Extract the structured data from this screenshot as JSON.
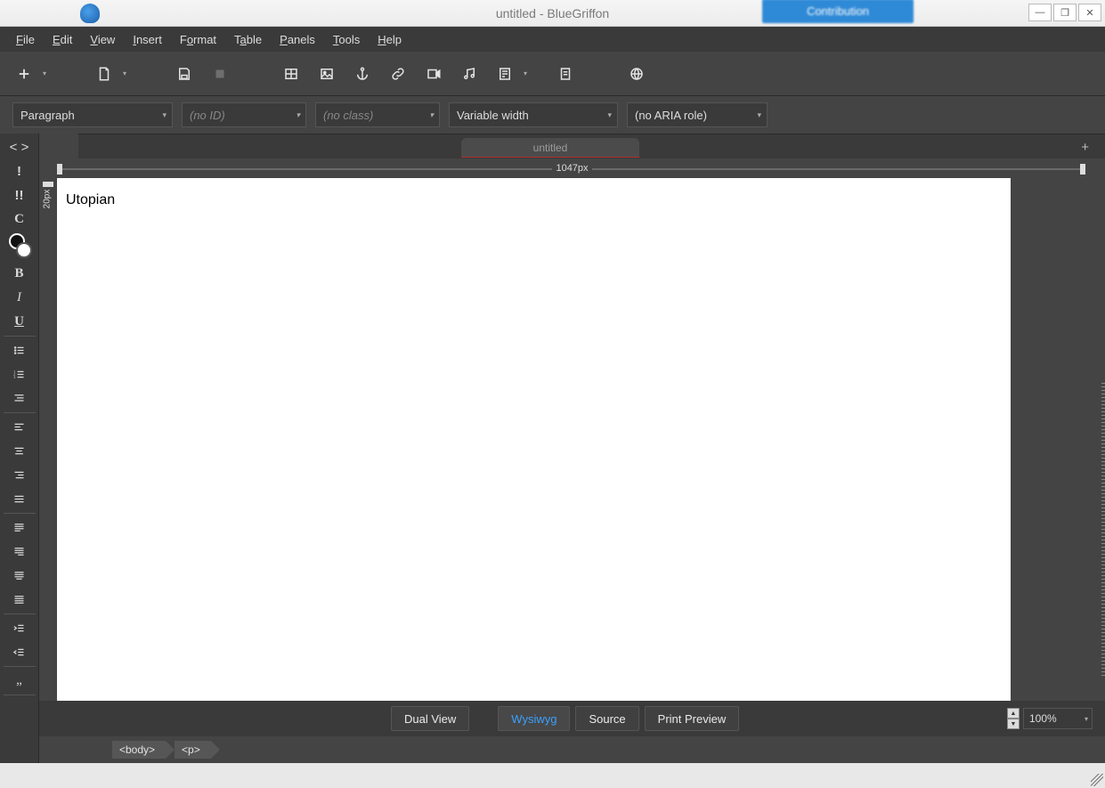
{
  "window": {
    "title": "untitled - BlueGriffon",
    "controls": {
      "min": "—",
      "max": "❐",
      "close": "✕"
    },
    "contribution_label": "Contribution"
  },
  "menu": {
    "items": [
      "File",
      "Edit",
      "View",
      "Insert",
      "Format",
      "Table",
      "Panels",
      "Tools",
      "Help"
    ]
  },
  "format_selects": {
    "paragraph": "Paragraph",
    "id_placeholder": "(no ID)",
    "class_placeholder": "(no class)",
    "font": "Variable width",
    "aria": "(no ARIA role)"
  },
  "tabs": {
    "active": "untitled",
    "new_tab": "+"
  },
  "ruler": {
    "width_label": "1047px",
    "v_label": "20px"
  },
  "document": {
    "content": "Utopian"
  },
  "view_buttons": {
    "dual": "Dual View",
    "wysiwyg": "Wysiwyg",
    "source": "Source",
    "print": "Print Preview"
  },
  "zoom": {
    "value": "100%"
  },
  "path": {
    "crumbs": [
      "<body>",
      "<p>"
    ]
  }
}
